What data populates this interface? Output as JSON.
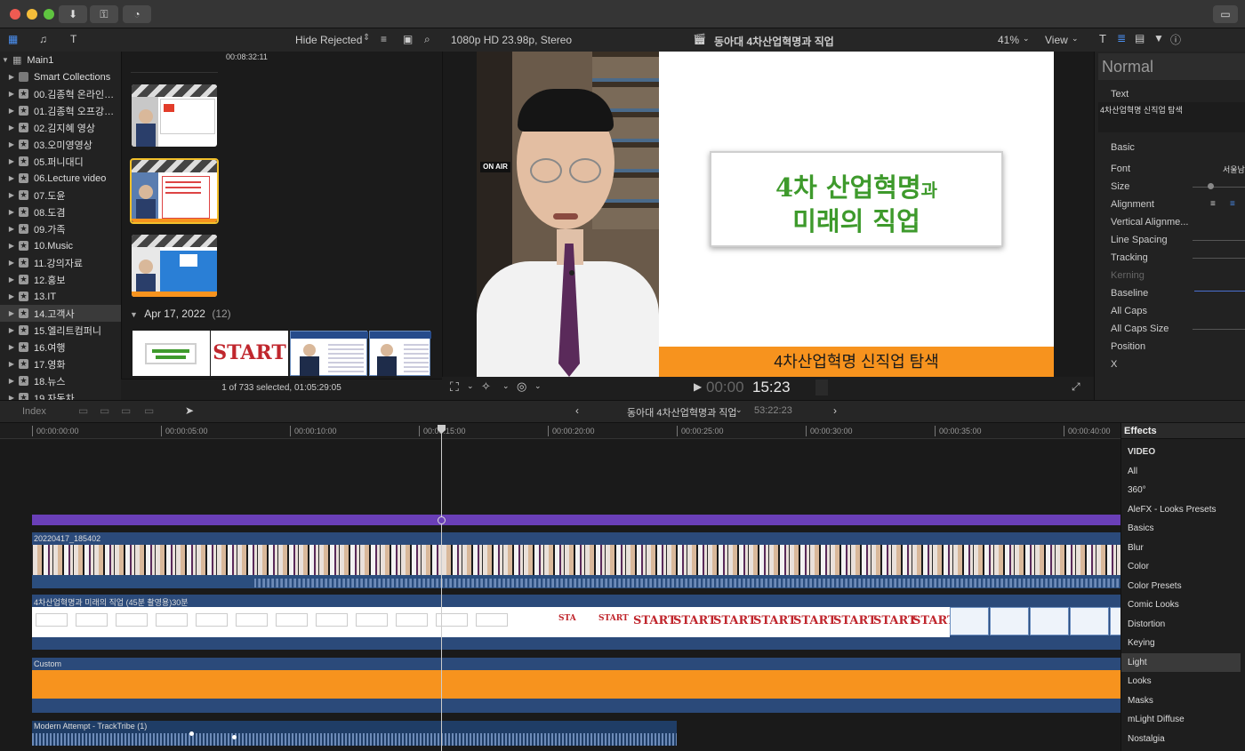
{
  "toolbar": {
    "hide_rejected": "Hide Rejected",
    "format": "1080p HD 23.98p, Stereo",
    "project_title": "동아대 4차산업혁명과 직업",
    "zoom": "41%",
    "view": "View"
  },
  "library": {
    "root": "Main1",
    "items": [
      "Smart Collections",
      "00.김종혁 온라인…",
      "01.김종혁 오프강…",
      "02.김지혜 영상",
      "03.오미영영상",
      "05.퍼니대디",
      "06.Lecture video",
      "07.도윤",
      "08.도겸",
      "09.가족",
      "10.Music",
      "11.강의자료",
      "12.홍보",
      "13.IT",
      "14.고객사",
      "15.엘리트컴퍼니",
      "16.여행",
      "17.영화",
      "18.뉴스",
      "19.자동차"
    ],
    "selected_index": 14
  },
  "browser": {
    "timecode": "00:08:32:11",
    "date_group": "Apr 17, 2022",
    "date_count": "(12)",
    "status": "1 of 733 selected, 01:05:29:05"
  },
  "viewer": {
    "on_air": "ON AIR",
    "slide_title_line1": "4차 산업혁명",
    "slide_title_suffix": "과",
    "slide_title_line2": "미래의 직업",
    "subtitle_bar": "4차산업혁명 신직업 탐색",
    "timecode_dim": "00:00",
    "timecode": "15:23"
  },
  "inspector": {
    "preset": "Normal",
    "text_label": "Text",
    "text_value": "4차산업혁명 신직업 탐색",
    "basic": "Basic",
    "font_value": "서울남",
    "rows": [
      "Font",
      "Size",
      "Alignment",
      "Vertical Alignme...",
      "Line Spacing",
      "Tracking",
      "Kerning",
      "Baseline",
      "All Caps",
      "All Caps Size",
      "Position",
      "X"
    ]
  },
  "timeline": {
    "index": "Index",
    "project": "동아대 4차산업혁명과 직업",
    "duration": "53:22:23",
    "ruler": [
      "00:00:00:00",
      "00:00:05:00",
      "00:00:10:00",
      "00:00:15:00",
      "00:00:20:00",
      "00:00:25:00",
      "00:00:30:00",
      "00:00:35:00",
      "00:00:40:00"
    ],
    "clip_video": "20220417_185402",
    "clip_slides": "4차산업혁명과 미래의 직업 (45분 촬영용)30분",
    "clip_custom": "Custom",
    "clip_audio": "Modern Attempt - TrackTribe (1)",
    "start_word": "START",
    "start_partial": "STA"
  },
  "effects": {
    "header": "Effects",
    "items": [
      "VIDEO",
      "All",
      "360°",
      "AleFX - Looks Presets",
      "Basics",
      "Blur",
      "Color",
      "Color Presets",
      "Comic Looks",
      "Distortion",
      "Keying",
      "Light",
      "Looks",
      "Masks",
      "mLight Diffuse",
      "Nostalgia"
    ],
    "selected": "Light"
  },
  "colors": {
    "accent_orange": "#f7931e",
    "slide_green": "#3e9a2c",
    "storyline_purple": "#6a3fb8",
    "selection_yellow": "#f2c02b"
  }
}
